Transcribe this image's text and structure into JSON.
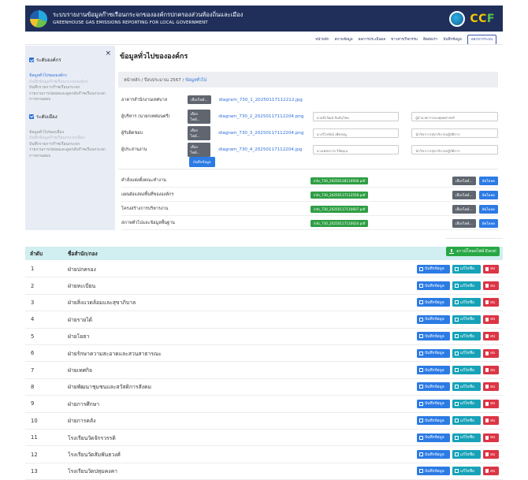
{
  "header": {
    "title_th": "ระบบรายงานข้อมูลก๊าซเรือนกระจกขององค์กรปกครองส่วนท้องถิ่นและเมือง",
    "title_en": "GREENHOUSE GAS EMISSIONS REPORTING FOR LOCAL GOVERNMENT",
    "brand": "CCF",
    "logo_icon": "tgo-logo-icon"
  },
  "nav": {
    "items": [
      "หน้าหลัก",
      "สถานข้อมูล",
      "ผลการประเมินผล",
      "ข่าวสาร/กิจกรรม",
      "ติดต่อเรา",
      "บันทึกข้อมูล"
    ],
    "logout_label": "ออกจากระบบ"
  },
  "sidebar": {
    "section1": "ระดับองค์กร",
    "links1": [
      {
        "label": "ข้อมูลทั่วไปขององค์กร",
        "state": "active"
      },
      {
        "label": "บันทึกข้อมูลก๊าซเรือนกระจกองค์กร",
        "state": "faded"
      },
      {
        "label": "บันทึกรายการก๊าซเรือนกระจก",
        "state": "normal"
      },
      {
        "label": "รายงานการปล่อยและดูดกลับก๊าซเรือนกระจก",
        "state": "normal"
      },
      {
        "label": "การทวนสอบ",
        "state": "normal"
      }
    ],
    "section2": "ระดับเมือง",
    "links2": [
      {
        "label": "ข้อมูลทั่วไปของเมือง",
        "state": "normal"
      },
      {
        "label": "บันทึกข้อมูลก๊าซเรือนกระจกเมือง",
        "state": "faded"
      },
      {
        "label": "บันทึกรายการก๊าซเรือนกระจก",
        "state": "normal"
      },
      {
        "label": "รายงานการปล่อยและดูดกลับก๊าซเรือนกระจก",
        "state": "normal"
      },
      {
        "label": "การทวนสอบ",
        "state": "normal"
      }
    ]
  },
  "main": {
    "title": "ข้อมูลทั่วไปขององค์กร",
    "breadcrumb": {
      "home": "หน้าหลัก",
      "year": "ปีงบประมาณ 2567",
      "current": "ข้อมูลทั่วไป"
    },
    "choose_file_label": "เลือกไฟล์...",
    "documents": [
      {
        "label": "อาคารสำนักงานเทศบาล",
        "file": "diagram_730_1_20250117112212.jpg",
        "input1": "",
        "input2": ""
      },
      {
        "label": "ผู้บริหาร (นายกเทศมนตรี)",
        "file": "diagram_730_2_20250117112204.png",
        "input1": "นายจีรวัฒน์ จินจันโทษ",
        "input2": "ผู้อำนวยการกองยุทธศาสตร์"
      },
      {
        "label": "ผู้รับผิดชอบ",
        "file": "diagram_730_3_20250117112204.png",
        "input1": "นางวิไลรัตน์ เพียรหนู",
        "input2": "นักวิชาการสุขาภิบาลปฏิบัติการ"
      },
      {
        "label": "ผู้ประสานงาน",
        "file": "diagram_730_4_20250117112204.jpg",
        "input1": "นางเพชรกาย วิสัยคุณ",
        "input2": "นักวิชาการสุขาภิบาลปฏิบัติการ"
      }
    ],
    "save_small": "บันทึกข้อมูล",
    "attachments": [
      {
        "label": "คำสั่งแต่งตั้งคณะทำงาน",
        "file": "info_730_20250128110930.pdf"
      },
      {
        "label": "แผนผังแสดงพื้นที่ขององค์กร",
        "file": "info_730_20250117112559.pdf"
      },
      {
        "label": "โครงสร้างการบริหารงาน",
        "file": "info_730_20250117110607.pdf"
      },
      {
        "label": "สภาพทั่วไปและข้อมูลพื้นฐาน",
        "file": "info_730_20250117110624.pdf"
      }
    ],
    "attach_choose": "เลือกไฟล์...",
    "attach_upload": "อัพโหลด"
  },
  "table": {
    "export_label": "ดาวน์โหลดไฟล์ Excel",
    "headers": {
      "no": "ลำดับ",
      "name": "ชื่อสำนัก/กอง"
    },
    "action_labels": {
      "save": "บันทึกข้อมูล",
      "edit": "แก้ไขชื่อ",
      "delete": "ลบ"
    },
    "rows": [
      {
        "no": "1",
        "name": "ฝ่ายปกครอง"
      },
      {
        "no": "2",
        "name": "ฝ่ายทะเบียน"
      },
      {
        "no": "3",
        "name": "ฝ่ายสิ่งแวดล้อมและสุขาภิบาล"
      },
      {
        "no": "4",
        "name": "ฝ่ายรายได้"
      },
      {
        "no": "5",
        "name": "ฝ่ายโยธา"
      },
      {
        "no": "6",
        "name": "ฝ่ายรักษาความสะอาดและสวนสาธารณะ"
      },
      {
        "no": "7",
        "name": "ฝ่ายเทศกิจ"
      },
      {
        "no": "8",
        "name": "ฝ่ายพัฒนาชุมชนและสวัสดิการสังคม"
      },
      {
        "no": "9",
        "name": "ฝ่ายการศึกษา"
      },
      {
        "no": "10",
        "name": "ฝ่ายการคลัง"
      },
      {
        "no": "11",
        "name": "โรงเรียนวัดจักรวรรดิ"
      },
      {
        "no": "12",
        "name": "โรงเรียนวัดสัมพันธวงศ์"
      },
      {
        "no": "13",
        "name": "โรงเรียนวัดปทุมคงคา"
      }
    ]
  },
  "colors": {
    "primary": "#2c7be5",
    "header": "#1f2f5a",
    "success": "#28a745",
    "info": "#17a2b8",
    "danger": "#dc3545"
  }
}
